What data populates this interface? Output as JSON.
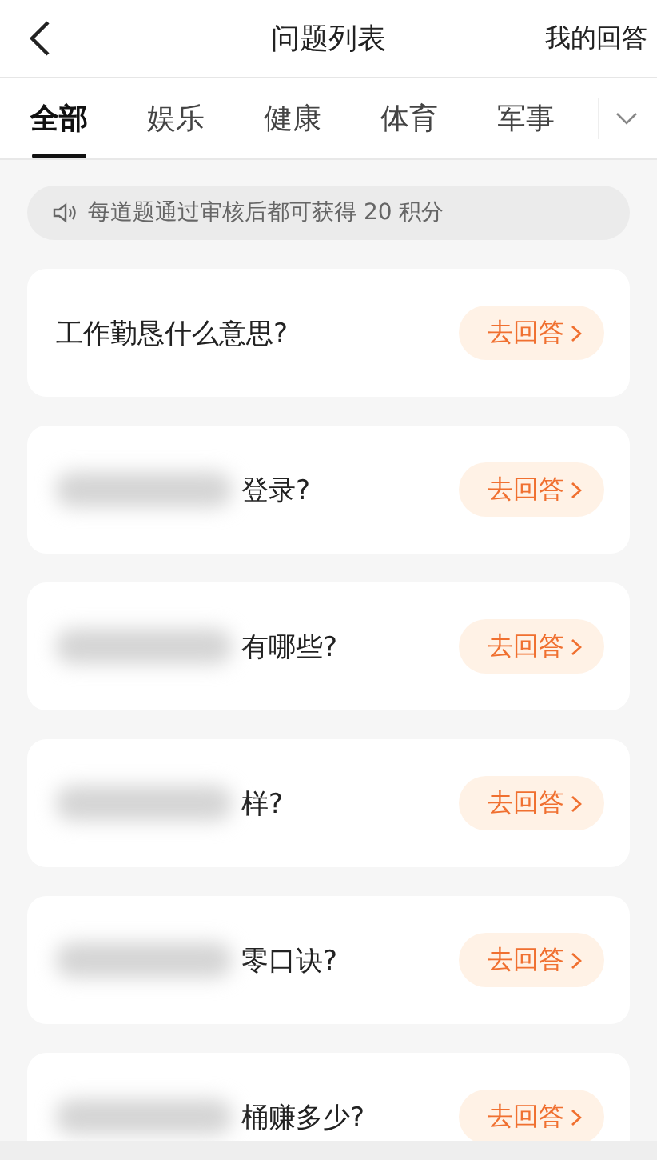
{
  "header": {
    "title": "问题列表",
    "action": "我的回答"
  },
  "tabs": [
    {
      "label": "全部",
      "selected": true
    },
    {
      "label": "娱乐",
      "selected": false
    },
    {
      "label": "健康",
      "selected": false
    },
    {
      "label": "体育",
      "selected": false
    },
    {
      "label": "军事",
      "selected": false
    }
  ],
  "notice": "每道题通过审核后都可获得 20 积分",
  "questions": [
    {
      "text": "工作勤恳什么意思?",
      "redacted": false,
      "button": "去回答"
    },
    {
      "text": "登录?",
      "redacted": true,
      "button": "去回答"
    },
    {
      "text": "有哪些?",
      "redacted": true,
      "button": "去回答"
    },
    {
      "text": "样?",
      "redacted": true,
      "button": "去回答"
    },
    {
      "text": "零口诀?",
      "redacted": true,
      "button": "去回答"
    },
    {
      "text": "桶赚多少?",
      "redacted": true,
      "button": "去回答"
    }
  ]
}
